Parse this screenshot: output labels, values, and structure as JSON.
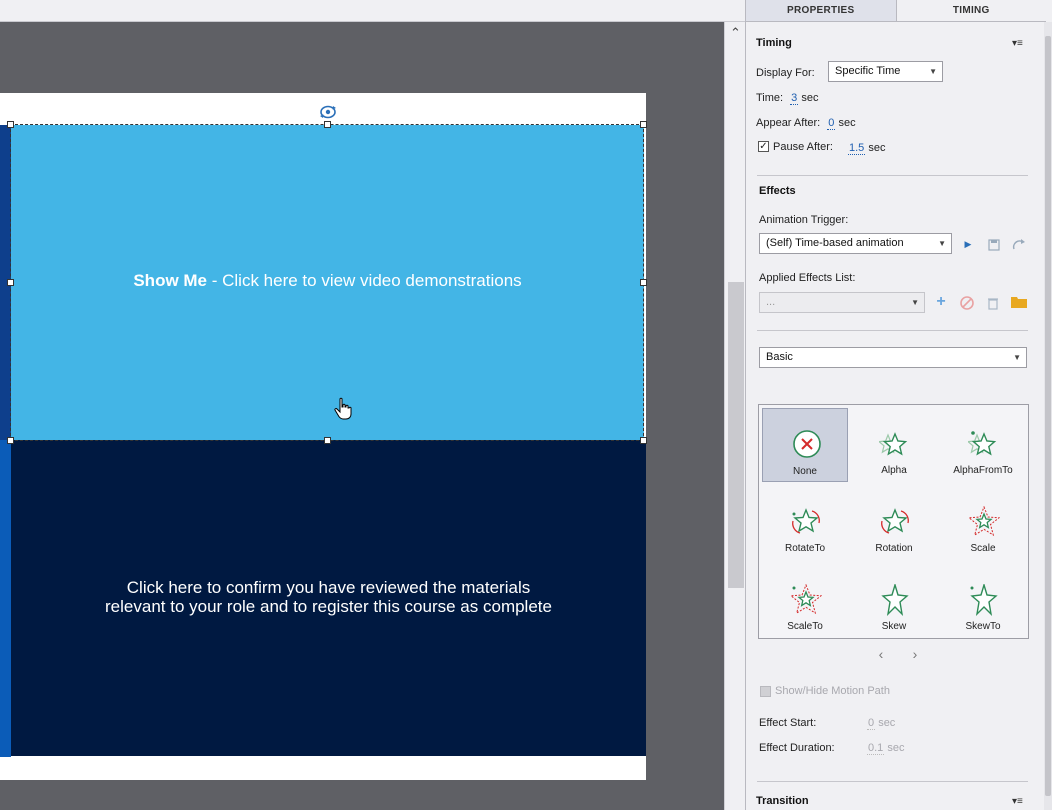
{
  "panel": {
    "tabs": [
      {
        "label": "PROPERTIES",
        "active": true
      },
      {
        "label": "TIMING",
        "active": false
      }
    ],
    "timing": {
      "title": "Timing",
      "display_for_label": "Display For:",
      "display_for_value": "Specific Time",
      "time_label": "Time:",
      "time_value": "3",
      "time_unit": "sec",
      "appear_after_label": "Appear After:",
      "appear_after_value": "0",
      "appear_after_unit": "sec",
      "pause_after_label": "Pause After:",
      "pause_after_value": "1.5",
      "pause_after_unit": "sec",
      "pause_after_checked": true
    },
    "effects": {
      "title": "Effects",
      "animation_trigger_label": "Animation Trigger:",
      "animation_trigger_value": "(Self) Time-based animation",
      "applied_effects_label": "Applied Effects List:",
      "applied_effects_value": "...",
      "category_value": "Basic",
      "items": [
        {
          "label": "None",
          "icon": "none-x-icon",
          "selected": true
        },
        {
          "label": "Alpha",
          "icon": "star-alpha-icon",
          "selected": false
        },
        {
          "label": "AlphaFromTo",
          "icon": "star-alpha-from-to-icon",
          "selected": false
        },
        {
          "label": "RotateTo",
          "icon": "star-rotate-to-icon",
          "selected": false
        },
        {
          "label": "Rotation",
          "icon": "star-rotation-icon",
          "selected": false
        },
        {
          "label": "Scale",
          "icon": "star-scale-icon",
          "selected": false
        },
        {
          "label": "ScaleTo",
          "icon": "star-scale-to-icon",
          "selected": false
        },
        {
          "label": "Skew",
          "icon": "star-skew-icon",
          "selected": false
        },
        {
          "label": "SkewTo",
          "icon": "star-skew-to-icon",
          "selected": false
        }
      ],
      "show_hide_motion_path_label": "Show/Hide Motion Path",
      "effect_start_label": "Effect Start:",
      "effect_start_value": "0",
      "effect_start_unit": "sec",
      "effect_duration_label": "Effect Duration:",
      "effect_duration_value": "0.1",
      "effect_duration_unit": "sec"
    },
    "transition": {
      "title": "Transition"
    }
  },
  "stage": {
    "show_me_bold": "Show Me",
    "show_me_rest": " - Click here to view video demonstrations",
    "confirm_line1": "Click here to confirm you have reviewed the materials",
    "confirm_line2": "relevant to your role and to register this course as complete"
  },
  "colors": {
    "show_me_bg": "#43b5e6",
    "confirm_bg": "#001941",
    "accent_blue": "#1f5fb0",
    "star_green": "#2e8b57",
    "effect_red": "#d42a2a"
  }
}
